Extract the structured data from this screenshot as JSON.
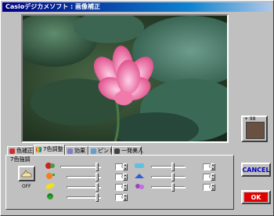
{
  "window": {
    "title": "Casioデジカメソフト : 画像補正"
  },
  "tabs": [
    {
      "label": "色補正",
      "icon": "color-correction-icon"
    },
    {
      "label": "7色調整",
      "icon": "seven-color-adjust-icon"
    },
    {
      "label": "効果",
      "icon": "effect-icon"
    },
    {
      "label": "ピント",
      "icon": "focus-icon"
    },
    {
      "label": "一発美人",
      "icon": "beauty-icon"
    }
  ],
  "active_tab": "7色調整",
  "panel": {
    "label": "7色強調",
    "off_label": "OFF",
    "sliders_left": [
      {
        "icon": "red-color-icon",
        "value": "0"
      },
      {
        "icon": "orange-color-icon",
        "value": "0"
      },
      {
        "icon": "yellow-color-icon",
        "value": "0"
      },
      {
        "icon": "green-color-icon",
        "value": "0"
      }
    ],
    "sliders_right": [
      {
        "icon": "cyan-color-icon",
        "value": "0"
      },
      {
        "icon": "blue-color-icon",
        "value": "0"
      },
      {
        "icon": "purple-color-icon",
        "value": "0"
      }
    ]
  },
  "buttons": {
    "cancel": "CANCEL",
    "ok": "OK",
    "thumbnail_label": "+ 98"
  },
  "colors": {
    "title_start": "#000080",
    "title_end": "#1084d0",
    "ok_red": "#e00000",
    "cancel_blue": "#0000c0"
  }
}
